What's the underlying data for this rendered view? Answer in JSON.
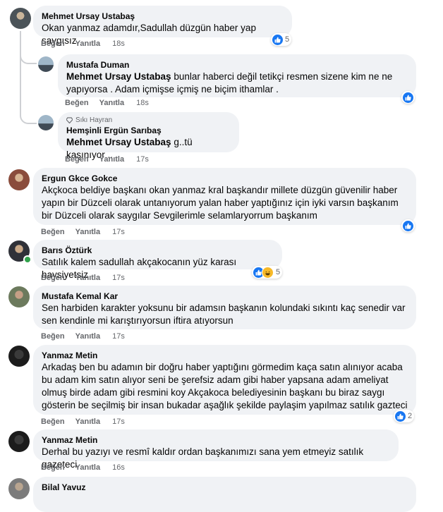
{
  "actions": {
    "like": "Beğen",
    "reply": "Yanıtla"
  },
  "comments": [
    {
      "author": "Mehmet Ursay Ustabaş",
      "text": "Okan yanmaz adamdır,Sadullah düzgün haber yap saygısız",
      "time": "18s",
      "reaction_count": "5"
    },
    {
      "author": "Mustafa Duman",
      "mention": "Mehmet Ursay Ustabaş",
      "text": " bunlar haberci değil tetikçi resmen sizene kim ne ne yapıyorsa . Adam içmişse içmiş ne biçim ithamlar .",
      "time": "18s"
    },
    {
      "badge": "Sıkı Hayran",
      "author": "Hemşinli Ergün Sarıbaş",
      "mention": "Mehmet Ursay Ustabaş",
      "text": " g..tü kaşınıyor ..",
      "time": "17s"
    },
    {
      "author": "Ergun Gkce Gokce",
      "text": "Akçkoca beldiye başkanı okan yanmaz kral başkandır millete düzgün güvenilir haber yapın bir Düzceli olarak untanıyorum yalan haber yaptığınız için iyki varsın başkanım bir Düzceli olarak saygılar Sevgilerimle selamlaryorrum başkanım",
      "time": "17s"
    },
    {
      "author": "Barıs Öztürk",
      "text": "Satılık kalem sadullah akçakocanın yüz karası haysiyetsiz",
      "time": "17s",
      "reaction_count": "5"
    },
    {
      "author": "Mustafa Kemal Kar",
      "text": "Sen harbiden karakter yoksunu bir adamsın başkanın kolundaki sıkıntı kaç senedir var sen kendinle mi karıştırıyorsun iftira atıyorsun",
      "time": "17s"
    },
    {
      "author": "Yanmaz Metin",
      "text": "Arkadaş ben bu adamın bir doğru haber yaptığını görmedim kaça satın alınıyor acaba bu adam kim satın alıyor seni be şerefsiz adam gibi haber yapsana adam ameliyat olmuş birde adam gibi resmini koy Akçakoca belediyesinin başkanı bu biraz saygı gösterin be seçilmiş bir insan bukadar aşağlık şekilde paylaşim yapılmaz satılık gazteci",
      "time": "17s",
      "reaction_count": "2"
    },
    {
      "author": "Yanmaz Metin",
      "text": "Derhal bu yazıyı ve resmî kaldır ordan başkanımızı sana yem etmeyiz satılık gazeteci",
      "time": "16s"
    },
    {
      "author": "Bilal Yavuz"
    }
  ],
  "colors": {
    "bubble": "#f0f2f5",
    "like_blue": "#1877f2",
    "meta_gray": "#65676b",
    "online_green": "#31a24c"
  },
  "icons": {
    "like": "thumbs-up-icon",
    "haha": "haha-emoji-icon",
    "fan_badge": "diamond-badge-icon"
  }
}
